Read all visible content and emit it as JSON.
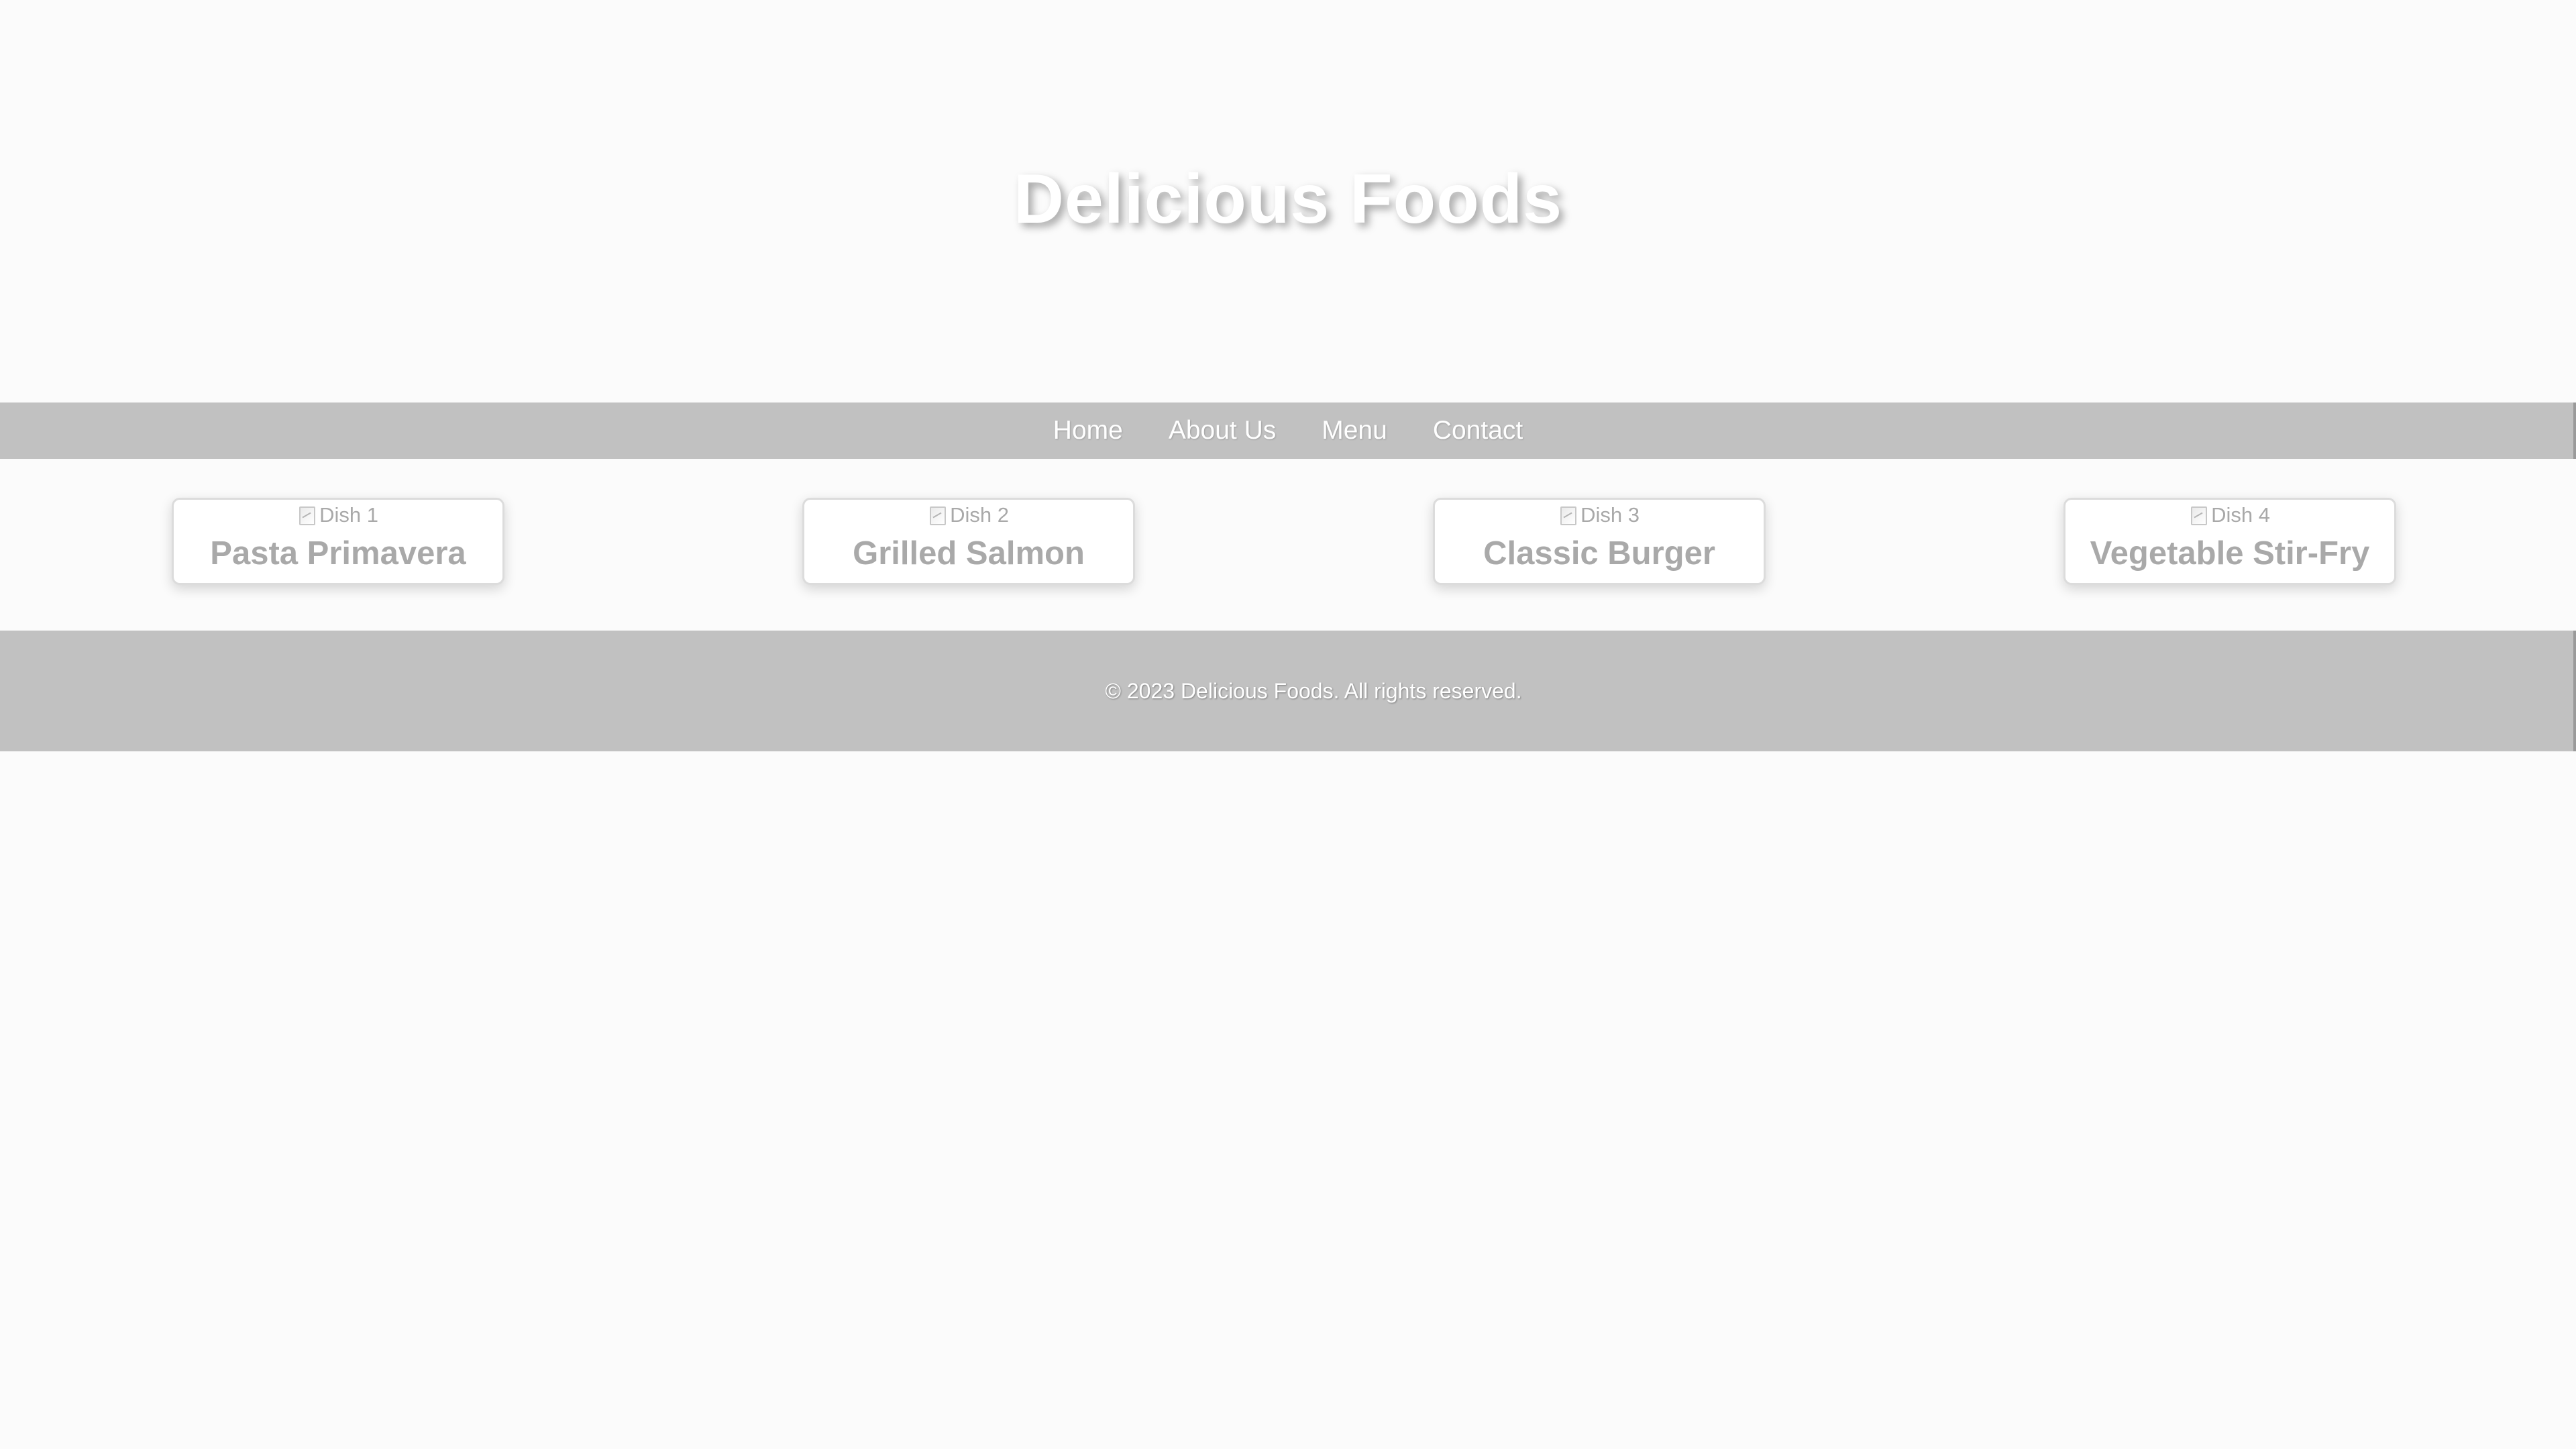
{
  "header": {
    "title": "Delicious Foods"
  },
  "nav": {
    "items": [
      {
        "label": "Home"
      },
      {
        "label": "About Us"
      },
      {
        "label": "Menu"
      },
      {
        "label": "Contact"
      }
    ]
  },
  "dishes": [
    {
      "image_alt": "Dish 1",
      "name": "Pasta Primavera"
    },
    {
      "image_alt": "Dish 2",
      "name": "Grilled Salmon"
    },
    {
      "image_alt": "Dish 3",
      "name": "Classic Burger"
    },
    {
      "image_alt": "Dish 4",
      "name": "Vegetable Stir-Fry"
    }
  ],
  "footer": {
    "copyright": "© 2023 Delicious Foods. All rights reserved."
  },
  "colors": {
    "page_background": "#fbfbfb",
    "bar_background": "#c1c1c1",
    "card_text": "#a9a9a9",
    "light_text": "#ffffff"
  },
  "icons": {
    "dish_image": "broken-image-icon"
  }
}
